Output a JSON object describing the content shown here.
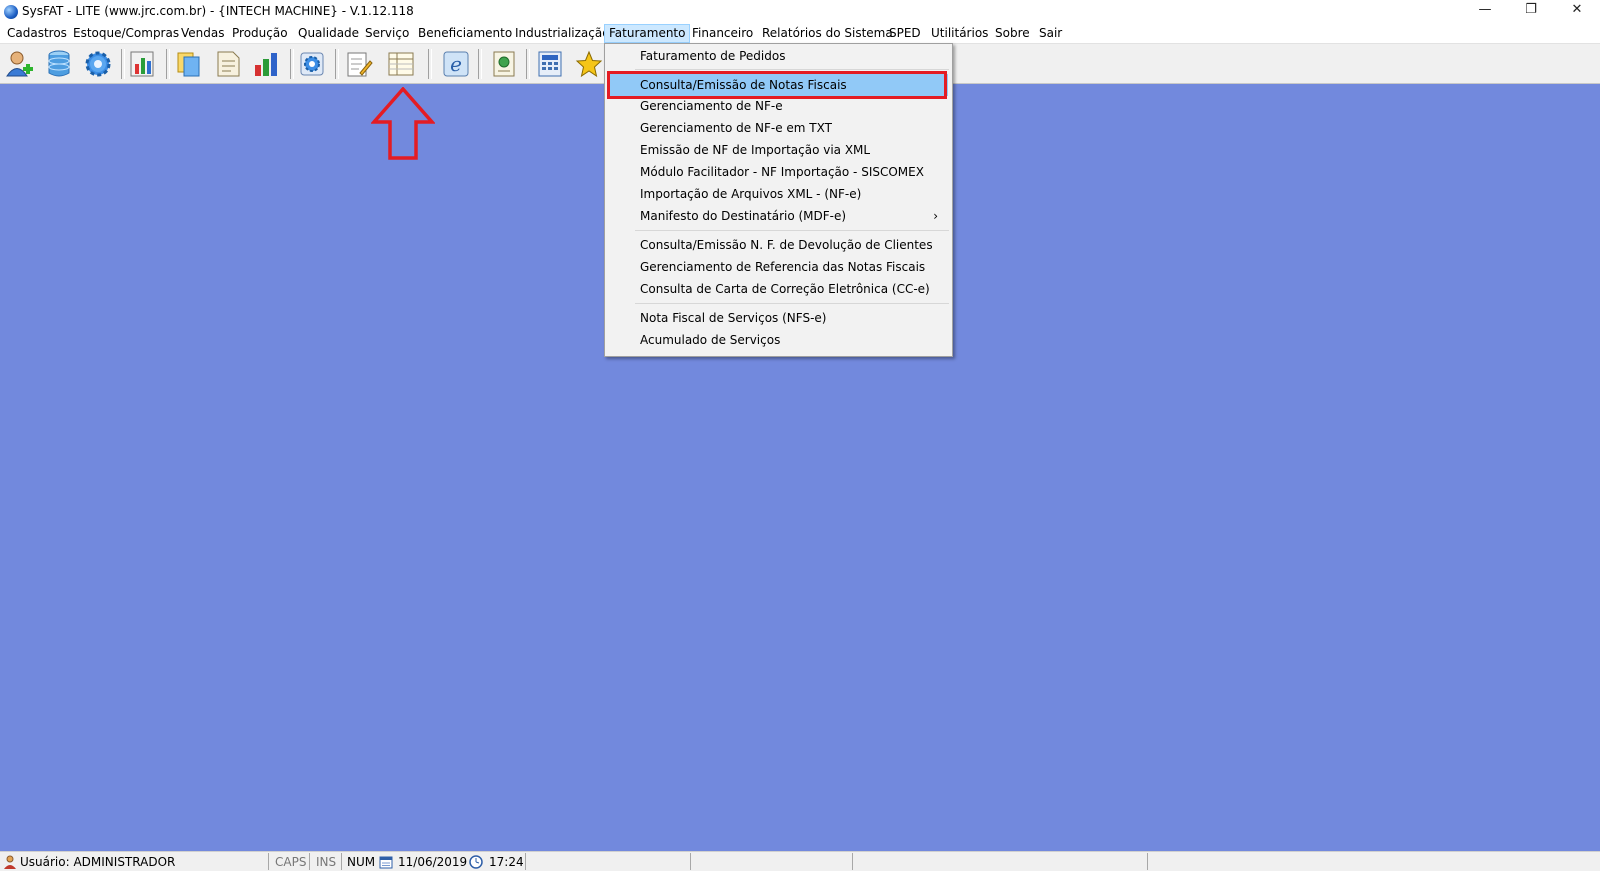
{
  "window": {
    "title": "SysFAT - LITE (www.jrc.com.br) - {INTECH MACHINE} - V.1.12.118",
    "minimize": "—",
    "restore": "❐",
    "close": "✕"
  },
  "menubar": [
    {
      "label": "Cadastros"
    },
    {
      "label": "Estoque/Compras"
    },
    {
      "label": "Vendas"
    },
    {
      "label": "Produção"
    },
    {
      "label": "Qualidade"
    },
    {
      "label": "Serviço"
    },
    {
      "label": "Beneficiamento"
    },
    {
      "label": "Industrialização"
    },
    {
      "label": "Faturamento"
    },
    {
      "label": "Financeiro"
    },
    {
      "label": "Relatórios do Sistema"
    },
    {
      "label": "SPED"
    },
    {
      "label": "Utilitários"
    },
    {
      "label": "Sobre"
    },
    {
      "label": "Sair"
    }
  ],
  "toolbar_icons": [
    "user-add-icon",
    "database-icon",
    "gear-icon",
    "report-chart-icon",
    "folders-icon",
    "document-icon",
    "bar-chart-icon",
    "settings-doc-icon",
    "edit-note-icon",
    "invoice-list-icon",
    "nfe-icon",
    "document-earth-icon",
    "calculator-icon",
    "star-icon"
  ],
  "dropdown": {
    "items": [
      {
        "label": "Faturamento de Pedidos"
      },
      {
        "label": "Consulta/Emissão de Notas Fiscais",
        "highlighted": true
      },
      {
        "label": "Gerenciamento de NF-e"
      },
      {
        "label": "Gerenciamento de NF-e em TXT"
      },
      {
        "label": "Emissão de NF de Importação via XML"
      },
      {
        "label": "Módulo Facilitador - NF Importação - SISCOMEX"
      },
      {
        "label": "Importação de Arquivos XML - (NF-e)"
      },
      {
        "label": "Manifesto do Destinatário (MDF-e)",
        "submenu": true,
        "arrow": "›"
      },
      {
        "label": "Consulta/Emissão N. F. de Devolução de Clientes"
      },
      {
        "label": "Gerenciamento de Referencia das Notas Fiscais"
      },
      {
        "label": "Consulta de Carta de Correção Eletrônica (CC-e)"
      },
      {
        "label": "Nota Fiscal de Serviços (NFS-e)"
      },
      {
        "label": "Acumulado de Serviços"
      }
    ]
  },
  "statusbar": {
    "user": "Usuário: ADMINISTRADOR",
    "caps": "CAPS",
    "ins": "INS",
    "num": "NUM",
    "date": "11/06/2019",
    "time": "17:24"
  },
  "colors": {
    "desktop": "#7289dd",
    "highlight": "#91c9f7",
    "annotation_red": "#e41c23"
  }
}
